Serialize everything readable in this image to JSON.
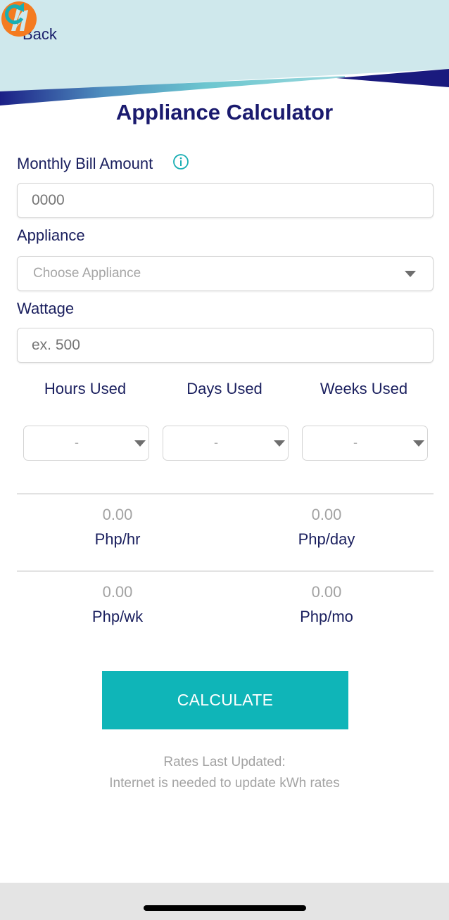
{
  "header": {
    "back_label": "Back",
    "logo_icon": "brand-lightning-m-logo",
    "refresh_icon": "refresh-icon",
    "colors": {
      "background": "#cfe8ec",
      "navy": "#1a1a7e",
      "teal": "#6cc6cf",
      "logo_orange": "#f47b20",
      "refresh": "#19aeb3"
    }
  },
  "page": {
    "title": "Appliance Calculator"
  },
  "form": {
    "monthly_bill": {
      "label": "Monthly Bill Amount",
      "info_icon": "info-icon",
      "placeholder": "0000",
      "value": ""
    },
    "appliance": {
      "label": "Appliance",
      "selected": "Choose Appliance"
    },
    "wattage": {
      "label": "Wattage",
      "placeholder": "ex. 500",
      "value": ""
    },
    "usage": [
      {
        "label": "Hours Used",
        "selected": "-"
      },
      {
        "label": "Days Used",
        "selected": "-"
      },
      {
        "label": "Weeks Used",
        "selected": "-"
      }
    ]
  },
  "results": [
    {
      "value": "0.00",
      "unit": "Php/hr"
    },
    {
      "value": "0.00",
      "unit": "Php/day"
    },
    {
      "value": "0.00",
      "unit": "Php/wk"
    },
    {
      "value": "0.00",
      "unit": "Php/mo"
    }
  ],
  "actions": {
    "calculate_label": "CALCULATE",
    "accent": "#0fb5b8"
  },
  "footer": {
    "rates_line": "Rates Last Updated:",
    "internet_line": "Internet is needed to update kWh rates"
  }
}
